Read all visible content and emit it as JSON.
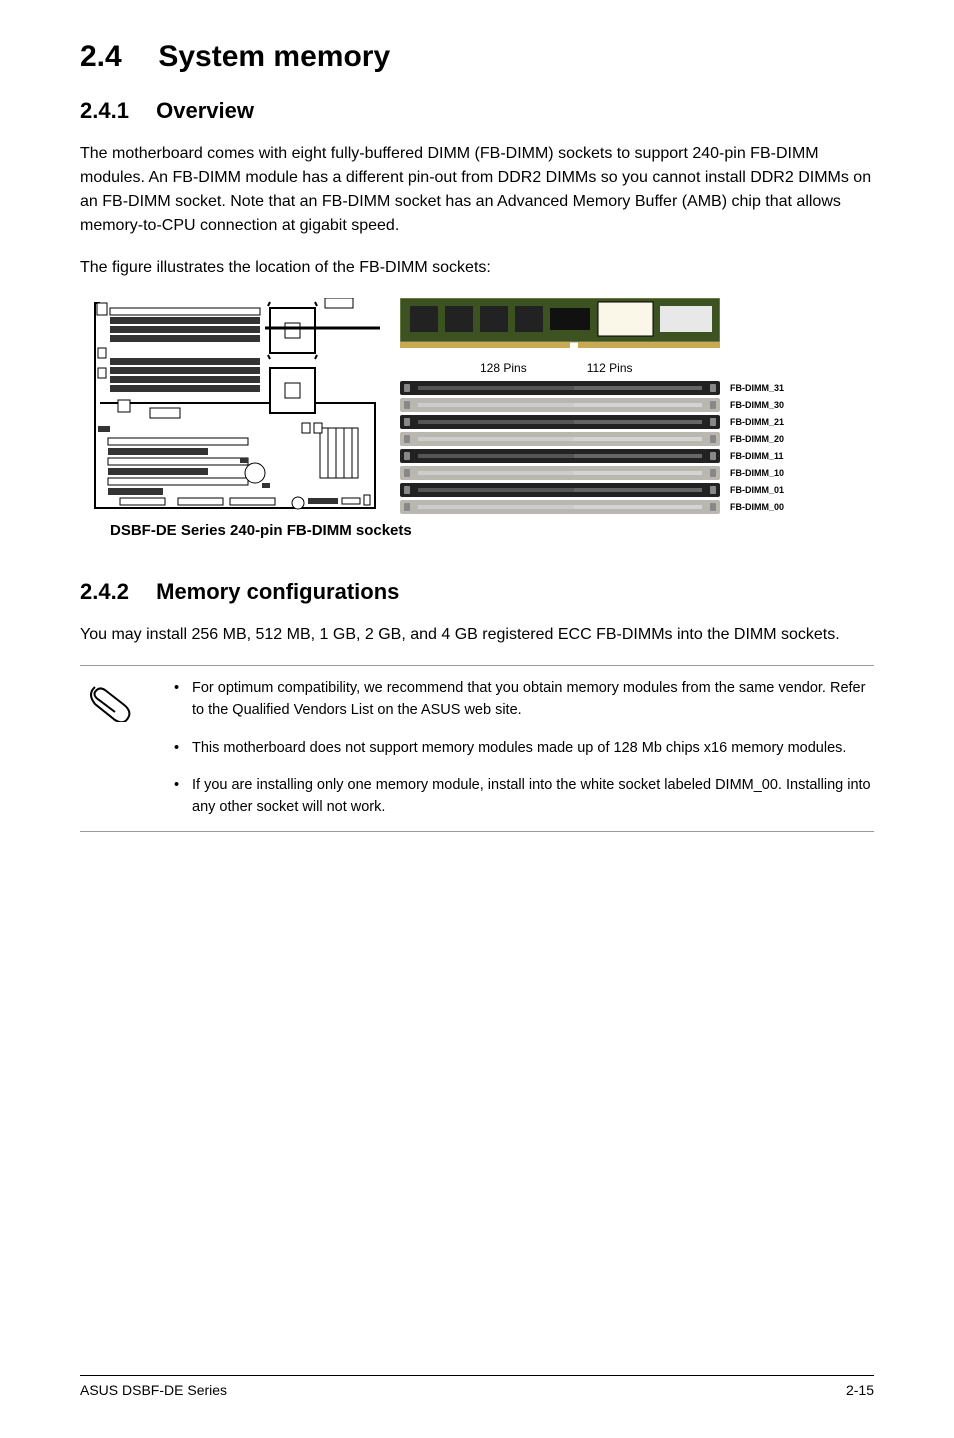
{
  "section": {
    "number": "2.4",
    "title": "System memory"
  },
  "subsection1": {
    "number": "2.4.1",
    "title": "Overview",
    "paragraph1": "The motherboard comes with eight fully-buffered DIMM (FB-DIMM) sockets to support 240-pin FB-DIMM modules. An FB-DIMM module has a different pin-out from DDR2 DIMMs so you cannot install DDR2 DIMMs on an FB-DIMM socket. Note that an FB-DIMM socket has an Advanced Memory Buffer (AMB) chip that allows memory-to-CPU connection at gigabit speed.",
    "paragraph2": "The figure illustrates the location of the FB-DIMM sockets:"
  },
  "figure": {
    "pins1": "128 Pins",
    "pins2": "112 Pins",
    "slots": [
      "FB-DIMM_31",
      "FB-DIMM_30",
      "FB-DIMM_21",
      "FB-DIMM_20",
      "FB-DIMM_11",
      "FB-DIMM_10",
      "FB-DIMM_01",
      "FB-DIMM_00"
    ],
    "caption": "DSBF-DE Series 240-pin FB-DIMM sockets"
  },
  "subsection2": {
    "number": "2.4.2",
    "title": "Memory configurations",
    "paragraph": "You may install 256 MB, 512 MB, 1 GB, 2 GB, and 4 GB registered ECC FB-DIMMs into the DIMM sockets."
  },
  "notes": [
    "For optimum compatibility, we recommend that you obtain memory modules from the same vendor. Refer to the Qualified Vendors List on the ASUS web site.",
    "This motherboard does not support memory modules made up of 128 Mb chips x16 memory modules.",
    "If you are installing only one memory module, install into the white socket labeled DIMM_00. Installing into any other socket will not work."
  ],
  "footer": {
    "left": "ASUS DSBF-DE Series",
    "right": "2-15"
  }
}
